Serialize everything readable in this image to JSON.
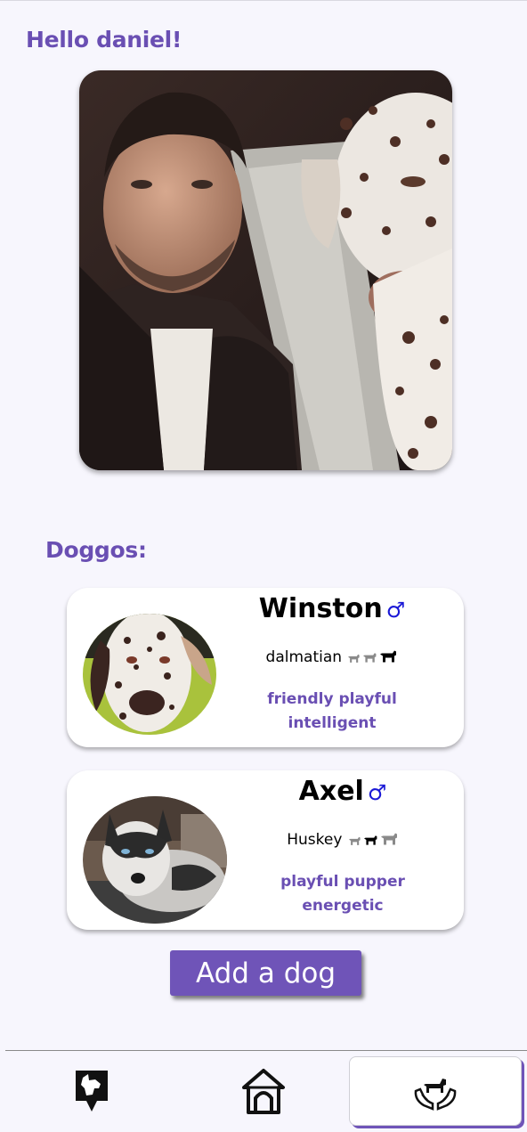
{
  "header": {
    "greeting": "Hello daniel!"
  },
  "section": {
    "title": "Doggos:"
  },
  "dogs": [
    {
      "name": "Winston",
      "gender_icon": "♂",
      "breed": "dalmatian",
      "size_selected": "large",
      "traits_line1": "friendly playful",
      "traits_line2": "intelligent"
    },
    {
      "name": "Axel",
      "gender_icon": "♂",
      "breed": "Huskey",
      "size_selected": "medium",
      "traits_line1": "playful pupper",
      "traits_line2": "energetic"
    }
  ],
  "actions": {
    "add_dog_label": "Add a dog"
  },
  "nav": {
    "items": [
      {
        "icon": "dog-location-pin-icon",
        "active": false
      },
      {
        "icon": "doghouse-icon",
        "active": false
      },
      {
        "icon": "hands-holding-dog-icon",
        "active": true
      }
    ]
  },
  "colors": {
    "accent": "#6a4fb3",
    "button": "#6f54b8",
    "gender": "#1a18d6",
    "background": "#f7f6fd"
  }
}
